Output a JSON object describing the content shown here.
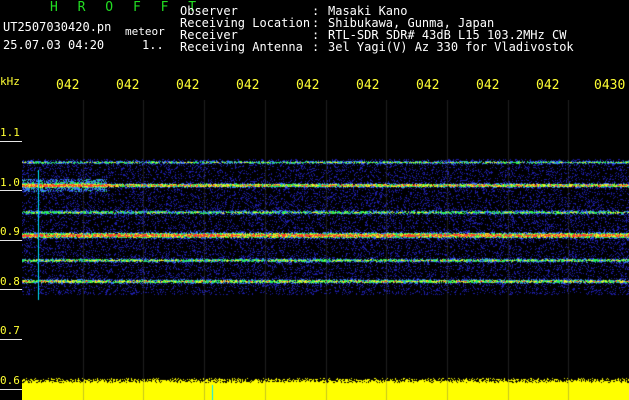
{
  "header": {
    "app_title": "H R O F F T",
    "file_name": "UT2507030420.pn",
    "app_subtitle": "meteor",
    "timestamp": "25.07.03 04:20",
    "frame_number": "1..",
    "info": [
      {
        "label": "Observer",
        "value": "Masaki Kano"
      },
      {
        "label": "Receiving Location",
        "value": "Shibukawa, Gunma, Japan"
      },
      {
        "label": "Receiver",
        "value": "RTL-SDR SDR# 43dB L15 103.2MHz CW"
      },
      {
        "label": "Receiving Antenna",
        "value": "3el Yagi(V) Az 330 for Vladivostok"
      }
    ]
  },
  "time_axis": {
    "labels": [
      "042",
      "042",
      "042",
      "042",
      "042",
      "042",
      "042",
      "042",
      "042",
      "0430"
    ]
  },
  "freq_axis": {
    "unit": "kHz",
    "labels": [
      "1.1",
      "1.0",
      "0.9",
      "0.8",
      "0.7",
      "0.6"
    ]
  },
  "colors": {
    "background": "#000000",
    "noise": "#1a1aa0",
    "band_low": "#2255ff",
    "band_mid": "#22ff55",
    "band_high": "#ff3322",
    "baseline": "#ffff00",
    "header_title": "#22dd22",
    "text": "#ffffff",
    "timeline": "#ffff33",
    "marker": "#00ffff"
  }
}
